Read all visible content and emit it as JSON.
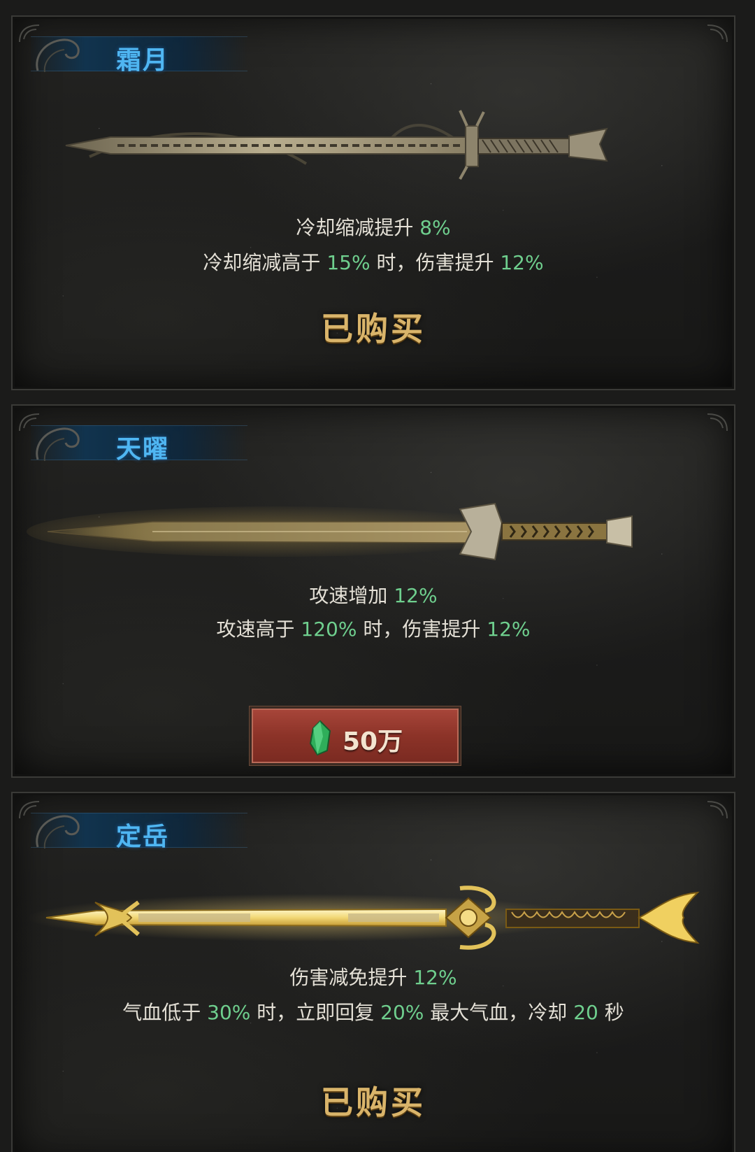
{
  "cards": [
    {
      "name": "霜月",
      "line1": {
        "a": "冷却缩减提升 ",
        "b": "8%"
      },
      "line2": {
        "a": "冷却缩减高于 ",
        "b": "15%",
        "c": " 时，伤害提升 ",
        "d": "12%"
      },
      "status": "已购买"
    },
    {
      "name": "天曜",
      "line1": {
        "a": "攻速增加 ",
        "b": "12%"
      },
      "line2": {
        "a": "攻速高于 ",
        "b": "120%",
        "c": " 时，伤害提升 ",
        "d": "12%"
      },
      "price": "50万",
      "price_icon": "green-crystal-icon"
    },
    {
      "name": "定岳",
      "line1": {
        "a": "伤害减免提升 ",
        "b": "12%"
      },
      "line2": {
        "a": "气血低于 ",
        "b": "30%",
        "c": " 时，立即回复 ",
        "d": "20%",
        "e": " 最大气血，冷却 ",
        "f": "20",
        "g": " 秒"
      },
      "status": "已购买"
    }
  ],
  "colors": {
    "title_blue": "#4fb6f2",
    "highlight_green": "#6fcf8e",
    "gold": "#d9b46a",
    "button_red": "#8c3328"
  }
}
